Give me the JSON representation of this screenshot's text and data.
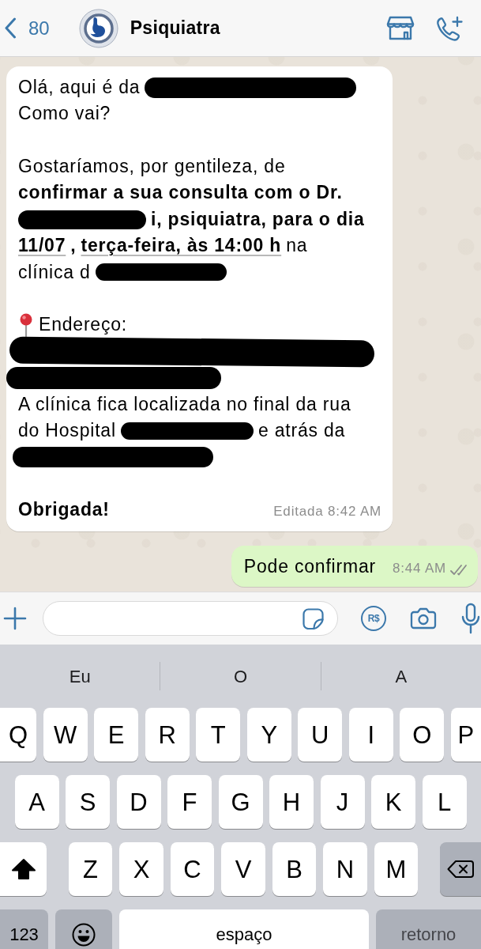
{
  "header": {
    "back_count": "80",
    "contact_name": "Psiquiatra"
  },
  "incoming_message": {
    "paragraphs": [
      {
        "lines": [
          [
            {
              "kind": "text",
              "text": "Olá, aqui é da"
            },
            {
              "kind": "redaction"
            }
          ],
          [
            {
              "kind": "text",
              "text": "Como vai?"
            }
          ]
        ]
      },
      {
        "lines": [
          [
            {
              "kind": "text",
              "text": "Gostaríamos, por gentileza, de"
            }
          ],
          [
            {
              "kind": "strong",
              "text": "confirmar a sua consulta com o Dr."
            }
          ],
          [
            {
              "kind": "redaction"
            },
            {
              "kind": "strong",
              "text": "i, psiquiatra, para o dia"
            }
          ],
          [
            {
              "kind": "link",
              "text": "11/07"
            },
            {
              "kind": "strong",
              "text": ","
            },
            {
              "kind": "link",
              "text": "terça-feira, às 14:00 h"
            },
            {
              "kind": "text",
              "text": "na"
            }
          ],
          [
            {
              "kind": "text",
              "text": "clínica d"
            },
            {
              "kind": "redaction"
            }
          ]
        ]
      },
      {
        "lines": [
          [
            {
              "kind": "pin"
            },
            {
              "kind": "text",
              "text": "Endereço:"
            }
          ],
          [
            {
              "kind": "redaction"
            }
          ],
          [
            {
              "kind": "redaction"
            }
          ],
          [
            {
              "kind": "text",
              "text": "A clínica fica localizada no final da rua"
            }
          ],
          [
            {
              "kind": "text",
              "text": "do Hospital"
            },
            {
              "kind": "redaction"
            },
            {
              "kind": "text",
              "text": "e atrás da"
            }
          ],
          [
            {
              "kind": "redaction"
            }
          ]
        ]
      },
      {
        "lines": [
          [
            {
              "kind": "strong",
              "text": "Obrigada!"
            }
          ]
        ]
      }
    ],
    "meta": "Editada 8:42 AM"
  },
  "outgoing_message": {
    "text": "Pode confirmar",
    "time": "8:44 AM",
    "delivered": true,
    "read": false
  },
  "composer": {
    "currency_symbol": "R$"
  },
  "keyboard": {
    "suggestions": [
      "Eu",
      "O",
      "A"
    ],
    "letter_rows": [
      [
        "Q",
        "W",
        "E",
        "R",
        "T",
        "Y",
        "U",
        "I",
        "O",
        "P"
      ],
      [
        "A",
        "S",
        "D",
        "F",
        "G",
        "H",
        "J",
        "K",
        "L"
      ],
      [
        "Z",
        "X",
        "C",
        "V",
        "B",
        "N",
        "M"
      ]
    ],
    "shift": {
      "on": true
    },
    "numbers_key": "123",
    "space_key": "espaço",
    "return_key": {
      "label": "retorno",
      "disabled": true
    }
  }
}
